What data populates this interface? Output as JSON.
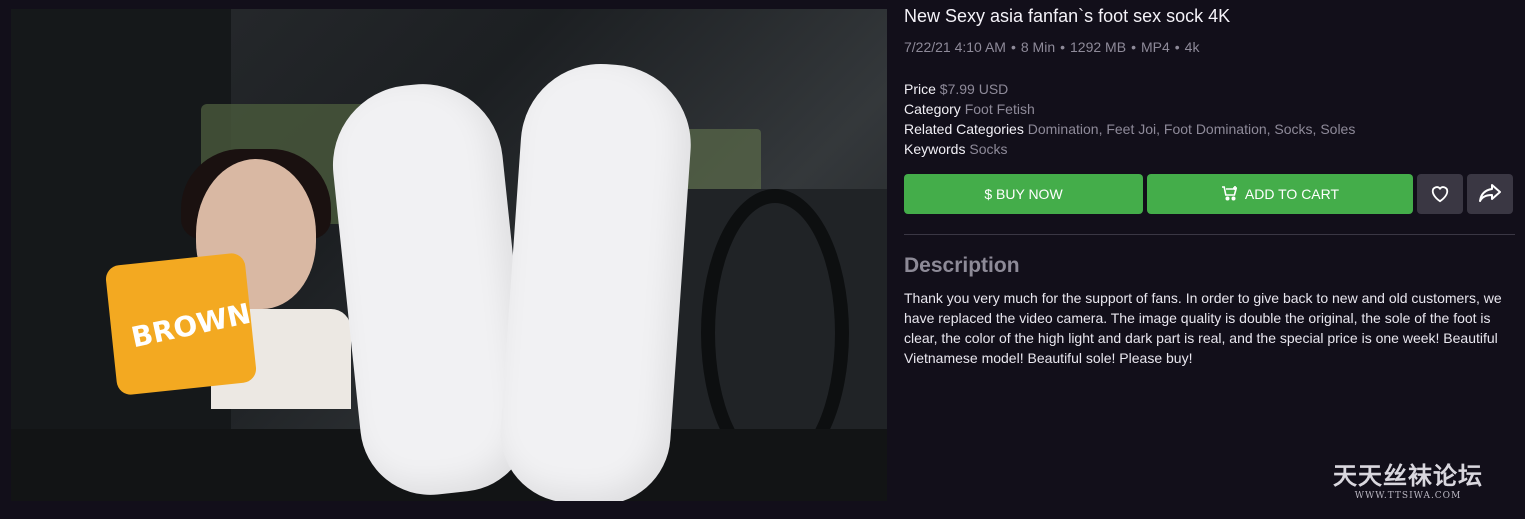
{
  "product": {
    "title": "New Sexy asia fanfan`s foot sex sock 4K",
    "meta": {
      "date": "7/22/21 4:10 AM",
      "duration": "8 Min",
      "size": "1292 MB",
      "format": "MP4",
      "quality": "4k",
      "separator": "•"
    },
    "thumbnail": {
      "pillow_text": "BROWN"
    },
    "details": {
      "price_label": "Price",
      "price_value": "$7.99 USD",
      "category_label": "Category",
      "category_value": "Foot Fetish",
      "related_label": "Related Categories",
      "related_value": "Domination, Feet Joi, Foot Domination, Socks, Soles",
      "keywords_label": "Keywords",
      "keywords_value": "Socks"
    }
  },
  "actions": {
    "buy_now": "$ BUY NOW",
    "add_to_cart": "ADD TO CART",
    "favorite_icon": "heart-icon",
    "share_icon": "share-icon",
    "button_color": "#44ad4a"
  },
  "description": {
    "heading": "Description",
    "text": "Thank you very much for the support of fans. In order to give back to new and old customers, we have replaced the video camera. The image quality is double the original, the sole of the foot is clear, the color of the high light and dark part is real, and the special price is one week! Beautiful Vietnamese model! Beautiful sole! Please buy!"
  },
  "watermark": {
    "title": "天天丝袜论坛",
    "url": "WWW.TTSIWA.COM"
  }
}
